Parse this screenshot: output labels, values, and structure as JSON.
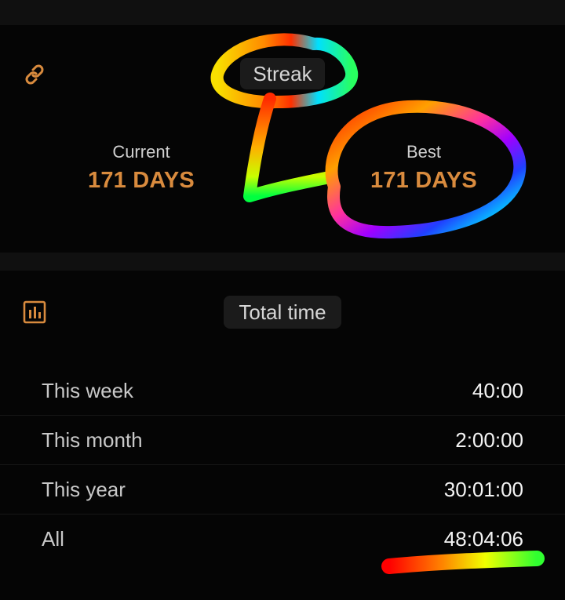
{
  "streak": {
    "title": "Streak",
    "icon": "link-icon",
    "current": {
      "label": "Current",
      "value": "171 DAYS"
    },
    "best": {
      "label": "Best",
      "value": "171 DAYS"
    }
  },
  "total_time": {
    "title": "Total time",
    "icon": "bar-chart-icon",
    "rows": [
      {
        "label": "This week",
        "value": "40:00"
      },
      {
        "label": "This month",
        "value": "2:00:00"
      },
      {
        "label": "This year",
        "value": "30:01:00"
      },
      {
        "label": "All",
        "value": "48:04:06"
      }
    ]
  },
  "colors": {
    "accent": "#d98b3e",
    "background": "#000000",
    "card": "#050505",
    "chip": "#1b1b1b"
  }
}
